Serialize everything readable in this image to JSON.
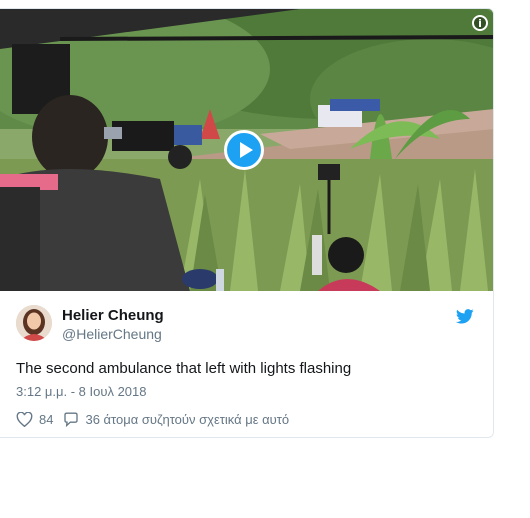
{
  "tweet": {
    "author_name": "Helier Cheung",
    "author_handle": "@HelierCheung",
    "text": "The second ambulance that left with lights flashing",
    "timestamp": "3:12 μ.μ. - 8 Ιουλ 2018",
    "likes": "84",
    "replies_text": "36 άτομα συζητούν σχετικά με αυτό"
  },
  "media": {
    "type": "video",
    "play_icon": "play-icon",
    "info_icon": "info-icon",
    "info_glyph": "i"
  },
  "icons": {
    "logo": "twitter-bird-icon",
    "like": "heart-icon",
    "reply": "speech-bubble-icon"
  },
  "colors": {
    "accent": "#1da1f2",
    "secondary_text": "#657786",
    "primary_text": "#14171a",
    "border": "#e1e8ed"
  }
}
